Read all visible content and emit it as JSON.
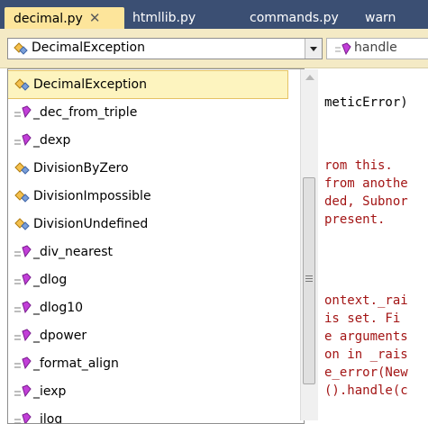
{
  "tabs": [
    {
      "label": "decimal.py",
      "active": true
    },
    {
      "label": "htmllib.py"
    },
    {
      "label": "commands.py"
    },
    {
      "label": "warn"
    }
  ],
  "nav": {
    "type_selector": "DecimalException",
    "member_selector": "handle"
  },
  "dropdown": {
    "items": [
      {
        "label": "DecimalException",
        "kind": "class",
        "selected": true
      },
      {
        "label": "_dec_from_triple",
        "kind": "function"
      },
      {
        "label": "_dexp",
        "kind": "function"
      },
      {
        "label": "DivisionByZero",
        "kind": "class"
      },
      {
        "label": "DivisionImpossible",
        "kind": "class"
      },
      {
        "label": "DivisionUndefined",
        "kind": "class"
      },
      {
        "label": "_div_nearest",
        "kind": "function"
      },
      {
        "label": "_dlog",
        "kind": "function"
      },
      {
        "label": "_dlog10",
        "kind": "function"
      },
      {
        "label": "_dpower",
        "kind": "function"
      },
      {
        "label": "_format_align",
        "kind": "function"
      },
      {
        "label": "_iexp",
        "kind": "function"
      },
      {
        "label": "_ilog",
        "kind": "function"
      }
    ]
  },
  "code": [
    {
      "text": "meticError)",
      "color": "#000000"
    },
    {
      "text": "rom this.",
      "color": "#a31515"
    },
    {
      "text": "from anothe",
      "color": "#a31515"
    },
    {
      "text": "ded, Subnor",
      "color": "#a31515"
    },
    {
      "text": " present.",
      "color": "#a31515"
    },
    {
      "text": "ontext._rai",
      "color": "#a31515"
    },
    {
      "text": "is set.  Fi",
      "color": "#a31515"
    },
    {
      "text": "e arguments",
      "color": "#a31515"
    },
    {
      "text": "on in _rais",
      "color": "#a31515"
    },
    {
      "text": "e_error(New",
      "color": "#a31515"
    },
    {
      "text": "().handle(c",
      "color": "#a31515"
    }
  ],
  "colors": {
    "tabbar": "#3b4f73",
    "active_tab": "#fde59b",
    "navbar": "#f4eac5",
    "string": "#a31515"
  }
}
